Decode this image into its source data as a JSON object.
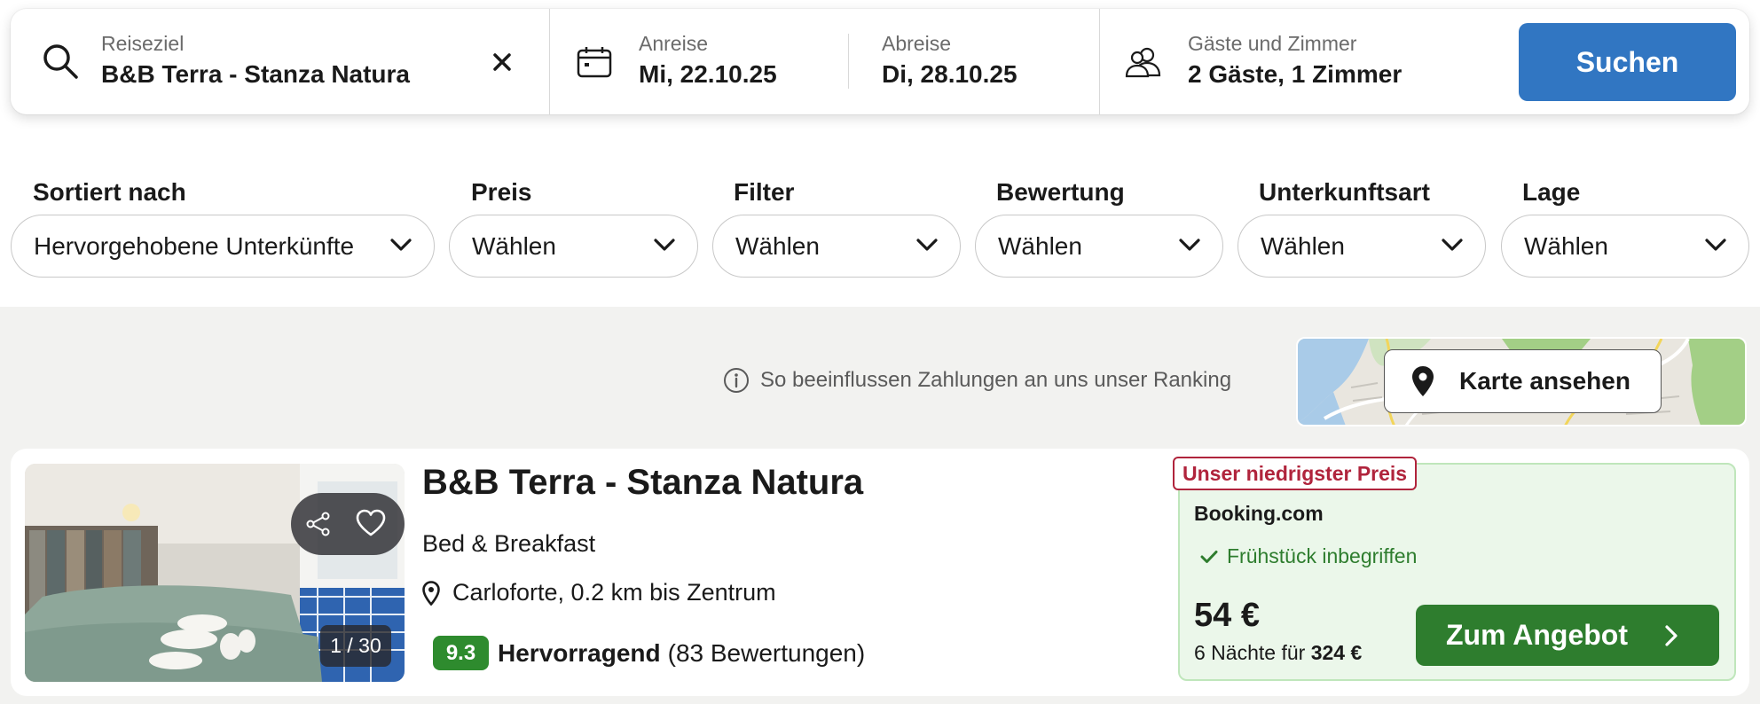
{
  "search": {
    "destination_label": "Reiseziel",
    "destination_value": "B&B Terra - Stanza Natura",
    "checkin_label": "Anreise",
    "checkin_value": "Mi, 22.10.25",
    "checkout_label": "Abreise",
    "checkout_value": "Di, 28.10.25",
    "guests_label": "Gäste und Zimmer",
    "guests_value": "2 Gäste, 1 Zimmer",
    "submit_label": "Suchen",
    "icons": [
      "search-icon",
      "clear-icon",
      "calendar-icon",
      "guests-icon"
    ]
  },
  "filters": [
    {
      "label": "Sortiert nach",
      "value": "Hervorgehobene Unterkünfte"
    },
    {
      "label": "Preis",
      "value": "Wählen"
    },
    {
      "label": "Filter",
      "value": "Wählen"
    },
    {
      "label": "Bewertung",
      "value": "Wählen"
    },
    {
      "label": "Unterkunftsart",
      "value": "Wählen"
    },
    {
      "label": "Lage",
      "value": "Wählen"
    }
  ],
  "ranking_info": "So beeinflussen Zahlungen an uns unser Ranking",
  "map_button_label": "Karte ansehen",
  "result": {
    "name": "B&B Terra - Stanza Natura",
    "type": "Bed & Breakfast",
    "location": "Carloforte, 0.2 km bis Zentrum",
    "rating_score": "9.3",
    "rating_text": "Hervorragend",
    "reviews": "(83 Bewertungen)",
    "photo_counter": "1 / 30",
    "offer": {
      "badge": "Unser niedrigster Preis",
      "provider": "Booking.com",
      "breakfast": "Frühstück inbegriffen",
      "price": "54 €",
      "nights_prefix": "6 Nächte für",
      "total": "324 €",
      "button_label": "Zum Angebot"
    }
  },
  "colors": {
    "primary": "#3176c2",
    "deal_green": "#2e7d2e",
    "rating_green": "#2e8b2e",
    "badge_red": "#b0243c",
    "offer_bg": "#ebf7ea",
    "page_bg": "#f2f2f0"
  }
}
